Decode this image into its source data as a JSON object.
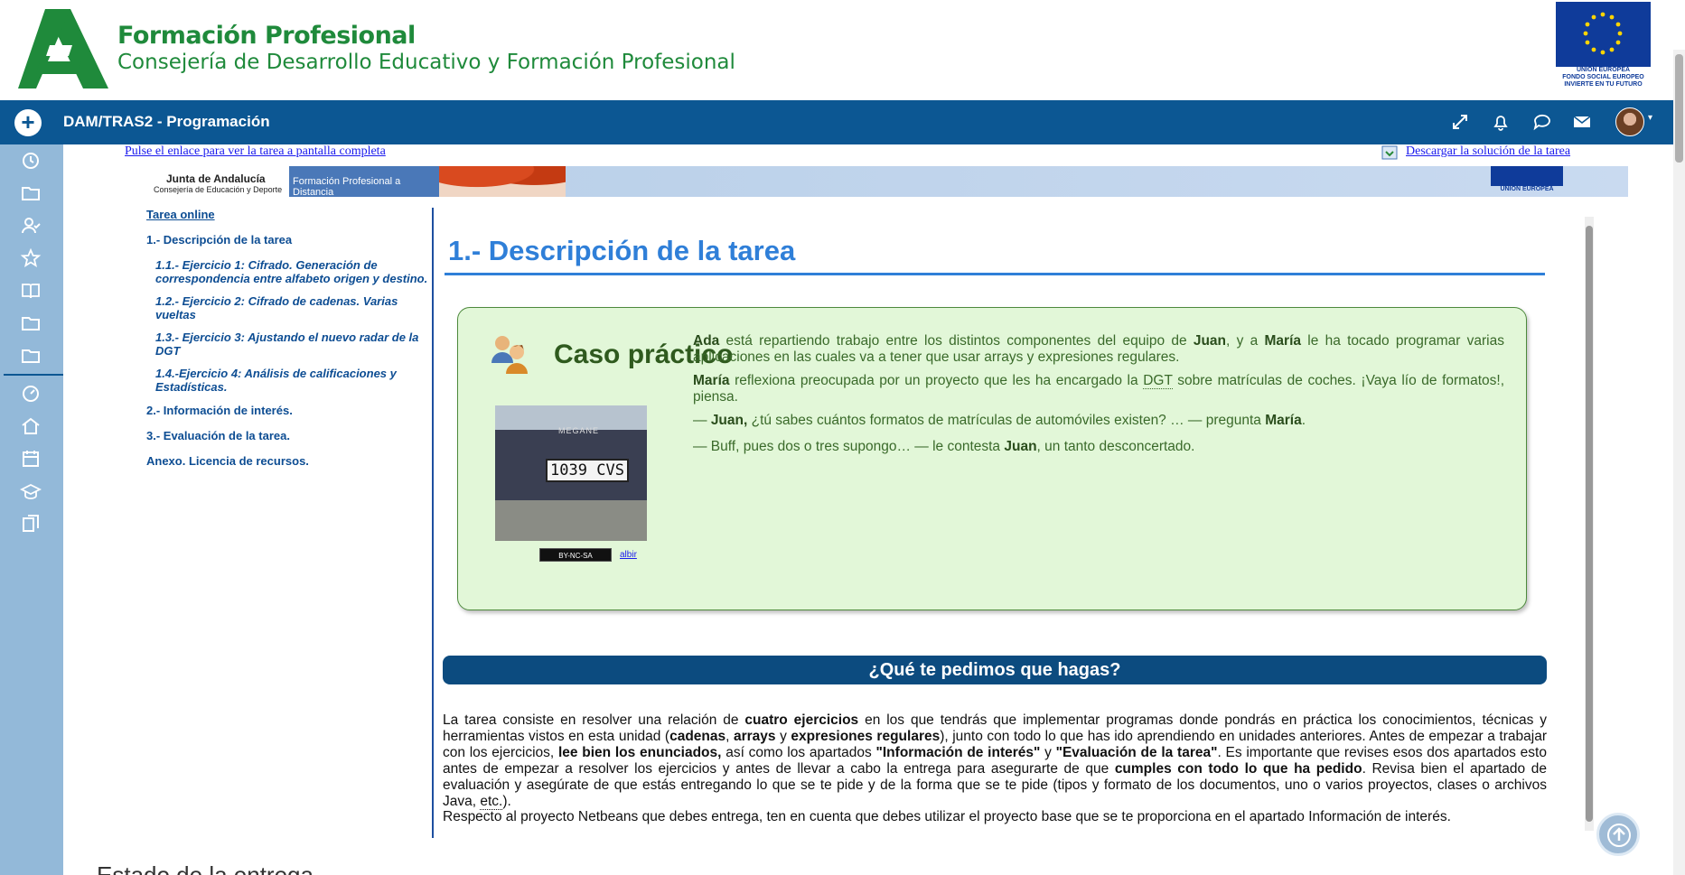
{
  "brand": {
    "title": "Formación Profesional",
    "subtitle": "Consejería de Desarrollo Educativo y Formación Profesional",
    "eu_label": "UNIÓN EUROPEA\nFONDO SOCIAL EUROPEO\nINVIERTE EN TU FUTURO"
  },
  "navbar": {
    "course_title": "DAM/TRAS2 - Programación",
    "icons": [
      "fullscreen-icon",
      "bell-icon",
      "chat-icon",
      "mail-icon"
    ]
  },
  "sidebar": {
    "icons": [
      "clock-icon",
      "folder-icon",
      "users-icon",
      "star-icon",
      "book-icon",
      "folder-icon",
      "folder-icon",
      "dashboard-icon",
      "home-icon",
      "calendar-icon",
      "graduation-icon",
      "copy-icon"
    ]
  },
  "links": {
    "fullscreen": "Pulse el enlace para ver la tarea a pantalla completa",
    "download": "Descargar la solución de la tarea"
  },
  "banner": {
    "junta": "Junta de Andalucía",
    "junta_sub": "Consejería de Educación y Deporte",
    "fp": "Formación Profesional a Distancia",
    "eu": "UNIÓN EUROPEA"
  },
  "toc": {
    "items": [
      "Tarea online",
      "1.- Descripción de la tarea",
      "1.1.- Ejercicio 1: Cifrado. Generación de correspondencia entre alfabeto origen y destino.",
      "1.2.- Ejercicio 2: Cifrado de cadenas. Varias vueltas",
      "1.3.- Ejercicio 3: Ajustando el nuevo radar de la DGT",
      "1.4.-Ejercicio 4: Análisis de calificaciones y Estadísticas.",
      "2.- Información de interés.",
      "3.- Evaluación de la tarea.",
      "Anexo. Licencia de recursos."
    ]
  },
  "content": {
    "heading": "1.- Descripción de la tarea",
    "caso_title": "Caso práctico",
    "plate": "1039 CVS",
    "car_brand": "MEGANE",
    "license": "BY-NC-SA",
    "credit": "albir",
    "p1_a": "Ada",
    "p1_b": " está repartiendo trabajo entre los distintos componentes del equipo de ",
    "p1_c": "Juan",
    "p1_d": ", y a ",
    "p1_e": "María",
    "p1_f": " le ha tocado programar varias aplicaciones en las cuales va a tener que usar arrays y expresiones regulares.",
    "p2_a": "María",
    "p2_b": " reflexiona preocupada por un proyecto que les ha encargado la ",
    "p2_c": "DGT",
    "p2_d": " sobre matrículas de coches. ¡Vaya lío de formatos!, piensa.",
    "p3_a": "— ",
    "p3_b": "Juan,",
    "p3_c": " ¿tú sabes cuántos formatos de matrículas de automóviles existen? … — pregunta ",
    "p3_d": "María",
    "p3_e": ".",
    "p4_a": "— Buff, pues dos o tres supongo… — le contesta ",
    "p4_b": "Juan",
    "p4_c": ", un tanto desconcertado.",
    "pedimos": "¿Qué te pedimos que hagas?",
    "b1_1": "La tarea consiste en resolver una relación de ",
    "b1_2": "cuatro ejercicios",
    "b1_3": " en los que tendrás que implementar programas donde pondrás en práctica los conocimientos, técnicas y herramientas vistos en esta unidad (",
    "b1_4": "cadenas",
    "b1_5": ", ",
    "b1_6": "arrays",
    "b1_7": " y ",
    "b1_8": "expresiones regulares",
    "b1_9": "), junto con todo lo que has ido aprendiendo en unidades anteriores. Antes de empezar a trabajar con los ejercicios, ",
    "b1_10": "lee bien los enunciados,",
    "b1_11": " así como los apartados ",
    "b1_12": "\"Información de interés\"",
    "b1_13": " y ",
    "b1_14": "\"Evaluación de la tarea\"",
    "b1_15": ". Es importante que revises esos dos apartados esto antes de empezar a resolver los ejercicios y antes de llevar a cabo la entrega para asegurarte de que ",
    "b1_16": "cumples con todo lo que ha pedido",
    "b1_17": ". Revisa bien el apartado de evaluación y asegúrate de que estás entregando lo que se te pide y de la forma que se te pide (tipos y formato de los documentos, uno o varios proyectos, clases o archivos Java, ",
    "b1_18": "etc.",
    "b1_19": ").",
    "b2": "Respecto al proyecto Netbeans que debes entrega, ten en cuenta que debes utilizar el proyecto base que se te proporciona en el apartado Información de interés."
  },
  "footer": {
    "estado": "Estado de la entrega"
  }
}
